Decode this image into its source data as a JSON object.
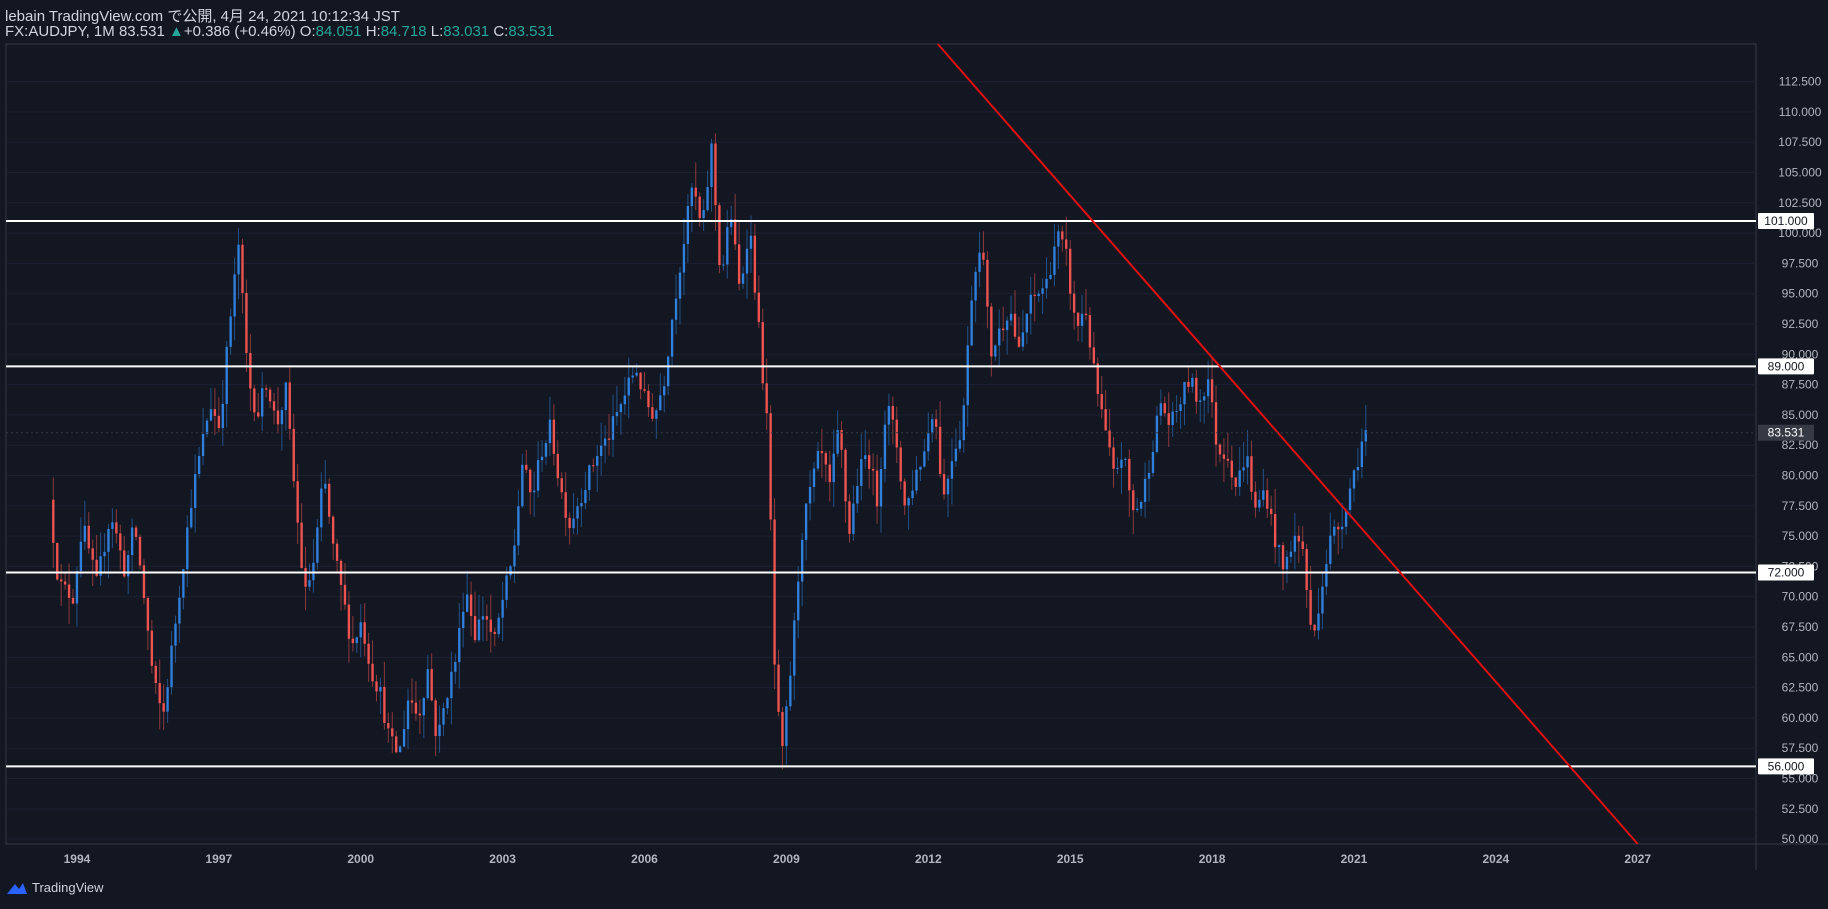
{
  "header": {
    "publish_line": "lebain TradingView.com で公開, 4月 24, 2021 10:12:34 JST",
    "symbol": "FX:AUDJPY, 1M",
    "last": "83.531",
    "change_arrow": "▲",
    "change": "+0.386 (+0.46%)",
    "open_label": "O:",
    "open": "84.051",
    "high_label": "H:",
    "high": "84.718",
    "low_label": "L:",
    "low": "83.031",
    "close_label": "C:",
    "close": "83.531"
  },
  "footer": {
    "brand": "TradingView",
    "logo_icon": "tradingview-logo-icon"
  },
  "colors": {
    "background": "#131722",
    "up": "#2f7fdc",
    "down": "#ef5350",
    "trendline": "#e01010",
    "level": "#ffffff",
    "axis_text": "#b2b5be",
    "last_price_label_bg": "#363a45"
  },
  "chart_data": {
    "type": "candlestick",
    "symbol": "FX:AUDJPY",
    "interval": "1M",
    "x_axis": {
      "ticks": [
        "1994",
        "1997",
        "2000",
        "2003",
        "2006",
        "2009",
        "2012",
        "2015",
        "2018",
        "2021",
        "2024",
        "2027"
      ],
      "range": [
        1992.5,
        2029.5
      ]
    },
    "y_axis": {
      "ticks": [
        "50.000",
        "52.500",
        "55.000",
        "57.500",
        "60.000",
        "62.500",
        "65.000",
        "67.500",
        "70.000",
        "72.500",
        "75.000",
        "77.500",
        "80.000",
        "82.500",
        "85.000",
        "87.500",
        "90.000",
        "92.500",
        "95.000",
        "97.500",
        "100.000",
        "102.500",
        "105.000",
        "107.500",
        "110.000",
        "112.500"
      ],
      "range": [
        49.6,
        115.6
      ]
    },
    "last_price": {
      "value": 83.531,
      "label": "83.531"
    },
    "horizontal_levels": [
      {
        "value": 101.0,
        "label": "101.000"
      },
      {
        "value": 89.0,
        "label": "89.000"
      },
      {
        "value": 72.0,
        "label": "72.000"
      },
      {
        "value": 56.0,
        "label": "56.000"
      }
    ],
    "trendline": {
      "points": [
        {
          "x": 2012.2,
          "y": 115.6
        },
        {
          "x": 2027.0,
          "y": 49.6
        }
      ]
    },
    "price_path": [
      {
        "t": 1993.5,
        "v": 78
      },
      {
        "t": 1993.7,
        "v": 71
      },
      {
        "t": 1994.0,
        "v": 70
      },
      {
        "t": 1994.2,
        "v": 76
      },
      {
        "t": 1994.5,
        "v": 71
      },
      {
        "t": 1994.8,
        "v": 77
      },
      {
        "t": 1995.1,
        "v": 72
      },
      {
        "t": 1995.3,
        "v": 76
      },
      {
        "t": 1995.5,
        "v": 70
      },
      {
        "t": 1995.7,
        "v": 63
      },
      {
        "t": 1995.9,
        "v": 60
      },
      {
        "t": 1996.1,
        "v": 66
      },
      {
        "t": 1996.3,
        "v": 72
      },
      {
        "t": 1996.5,
        "v": 78
      },
      {
        "t": 1996.7,
        "v": 82
      },
      {
        "t": 1996.9,
        "v": 86
      },
      {
        "t": 1997.1,
        "v": 84
      },
      {
        "t": 1997.3,
        "v": 92
      },
      {
        "t": 1997.5,
        "v": 99
      },
      {
        "t": 1997.7,
        "v": 88
      },
      {
        "t": 1997.9,
        "v": 85
      },
      {
        "t": 1998.1,
        "v": 88
      },
      {
        "t": 1998.3,
        "v": 84
      },
      {
        "t": 1998.5,
        "v": 87
      },
      {
        "t": 1998.7,
        "v": 78
      },
      {
        "t": 1998.9,
        "v": 70
      },
      {
        "t": 1999.1,
        "v": 73
      },
      {
        "t": 1999.3,
        "v": 80
      },
      {
        "t": 1999.5,
        "v": 74
      },
      {
        "t": 1999.7,
        "v": 70
      },
      {
        "t": 1999.9,
        "v": 66
      },
      {
        "t": 2000.1,
        "v": 68
      },
      {
        "t": 2000.3,
        "v": 64
      },
      {
        "t": 2000.5,
        "v": 62
      },
      {
        "t": 2000.7,
        "v": 58
      },
      {
        "t": 2000.9,
        "v": 57
      },
      {
        "t": 2001.1,
        "v": 62
      },
      {
        "t": 2001.3,
        "v": 60
      },
      {
        "t": 2001.5,
        "v": 64
      },
      {
        "t": 2001.7,
        "v": 58
      },
      {
        "t": 2001.9,
        "v": 62
      },
      {
        "t": 2002.1,
        "v": 65
      },
      {
        "t": 2002.3,
        "v": 71
      },
      {
        "t": 2002.5,
        "v": 67
      },
      {
        "t": 2002.7,
        "v": 69
      },
      {
        "t": 2002.9,
        "v": 66
      },
      {
        "t": 2003.1,
        "v": 70
      },
      {
        "t": 2003.3,
        "v": 73
      },
      {
        "t": 2003.5,
        "v": 81
      },
      {
        "t": 2003.7,
        "v": 78
      },
      {
        "t": 2003.9,
        "v": 82
      },
      {
        "t": 2004.1,
        "v": 84
      },
      {
        "t": 2004.3,
        "v": 79
      },
      {
        "t": 2004.5,
        "v": 76
      },
      {
        "t": 2004.7,
        "v": 78
      },
      {
        "t": 2004.9,
        "v": 80
      },
      {
        "t": 2005.1,
        "v": 82
      },
      {
        "t": 2005.3,
        "v": 83
      },
      {
        "t": 2005.5,
        "v": 85
      },
      {
        "t": 2005.7,
        "v": 87
      },
      {
        "t": 2005.9,
        "v": 89
      },
      {
        "t": 2006.1,
        "v": 86
      },
      {
        "t": 2006.3,
        "v": 85
      },
      {
        "t": 2006.5,
        "v": 88
      },
      {
        "t": 2006.7,
        "v": 94
      },
      {
        "t": 2006.9,
        "v": 99
      },
      {
        "t": 2007.1,
        "v": 104
      },
      {
        "t": 2007.3,
        "v": 100
      },
      {
        "t": 2007.5,
        "v": 107
      },
      {
        "t": 2007.7,
        "v": 96
      },
      {
        "t": 2007.9,
        "v": 102
      },
      {
        "t": 2008.1,
        "v": 95
      },
      {
        "t": 2008.3,
        "v": 101
      },
      {
        "t": 2008.5,
        "v": 92
      },
      {
        "t": 2008.7,
        "v": 83
      },
      {
        "t": 2008.85,
        "v": 62
      },
      {
        "t": 2009.0,
        "v": 57
      },
      {
        "t": 2009.2,
        "v": 65
      },
      {
        "t": 2009.4,
        "v": 75
      },
      {
        "t": 2009.6,
        "v": 79
      },
      {
        "t": 2009.8,
        "v": 82
      },
      {
        "t": 2010.0,
        "v": 79
      },
      {
        "t": 2010.2,
        "v": 84
      },
      {
        "t": 2010.4,
        "v": 75
      },
      {
        "t": 2010.6,
        "v": 80
      },
      {
        "t": 2010.8,
        "v": 82
      },
      {
        "t": 2011.0,
        "v": 78
      },
      {
        "t": 2011.2,
        "v": 86
      },
      {
        "t": 2011.4,
        "v": 83
      },
      {
        "t": 2011.6,
        "v": 77
      },
      {
        "t": 2011.8,
        "v": 80
      },
      {
        "t": 2012.0,
        "v": 82
      },
      {
        "t": 2012.2,
        "v": 86
      },
      {
        "t": 2012.4,
        "v": 78
      },
      {
        "t": 2012.6,
        "v": 82
      },
      {
        "t": 2012.8,
        "v": 84
      },
      {
        "t": 2013.0,
        "v": 95
      },
      {
        "t": 2013.2,
        "v": 100
      },
      {
        "t": 2013.4,
        "v": 90
      },
      {
        "t": 2013.6,
        "v": 92
      },
      {
        "t": 2013.8,
        "v": 94
      },
      {
        "t": 2014.0,
        "v": 90
      },
      {
        "t": 2014.2,
        "v": 94
      },
      {
        "t": 2014.4,
        "v": 95
      },
      {
        "t": 2014.6,
        "v": 96
      },
      {
        "t": 2014.8,
        "v": 100
      },
      {
        "t": 2015.0,
        "v": 98
      },
      {
        "t": 2015.2,
        "v": 92
      },
      {
        "t": 2015.4,
        "v": 94
      },
      {
        "t": 2015.6,
        "v": 88
      },
      {
        "t": 2015.8,
        "v": 84
      },
      {
        "t": 2016.0,
        "v": 80
      },
      {
        "t": 2016.2,
        "v": 82
      },
      {
        "t": 2016.4,
        "v": 77
      },
      {
        "t": 2016.6,
        "v": 78
      },
      {
        "t": 2016.8,
        "v": 82
      },
      {
        "t": 2017.0,
        "v": 86
      },
      {
        "t": 2017.2,
        "v": 84
      },
      {
        "t": 2017.4,
        "v": 86
      },
      {
        "t": 2017.6,
        "v": 88
      },
      {
        "t": 2017.8,
        "v": 86
      },
      {
        "t": 2018.0,
        "v": 88
      },
      {
        "t": 2018.2,
        "v": 82
      },
      {
        "t": 2018.4,
        "v": 82
      },
      {
        "t": 2018.6,
        "v": 79
      },
      {
        "t": 2018.8,
        "v": 82
      },
      {
        "t": 2019.0,
        "v": 77
      },
      {
        "t": 2019.2,
        "v": 79
      },
      {
        "t": 2019.4,
        "v": 75
      },
      {
        "t": 2019.6,
        "v": 72
      },
      {
        "t": 2019.8,
        "v": 75
      },
      {
        "t": 2020.0,
        "v": 74
      },
      {
        "t": 2020.2,
        "v": 66
      },
      {
        "t": 2020.4,
        "v": 71
      },
      {
        "t": 2020.6,
        "v": 75
      },
      {
        "t": 2020.8,
        "v": 76
      },
      {
        "t": 2021.0,
        "v": 79
      },
      {
        "t": 2021.2,
        "v": 82
      },
      {
        "t": 2021.3,
        "v": 83.5
      }
    ]
  }
}
